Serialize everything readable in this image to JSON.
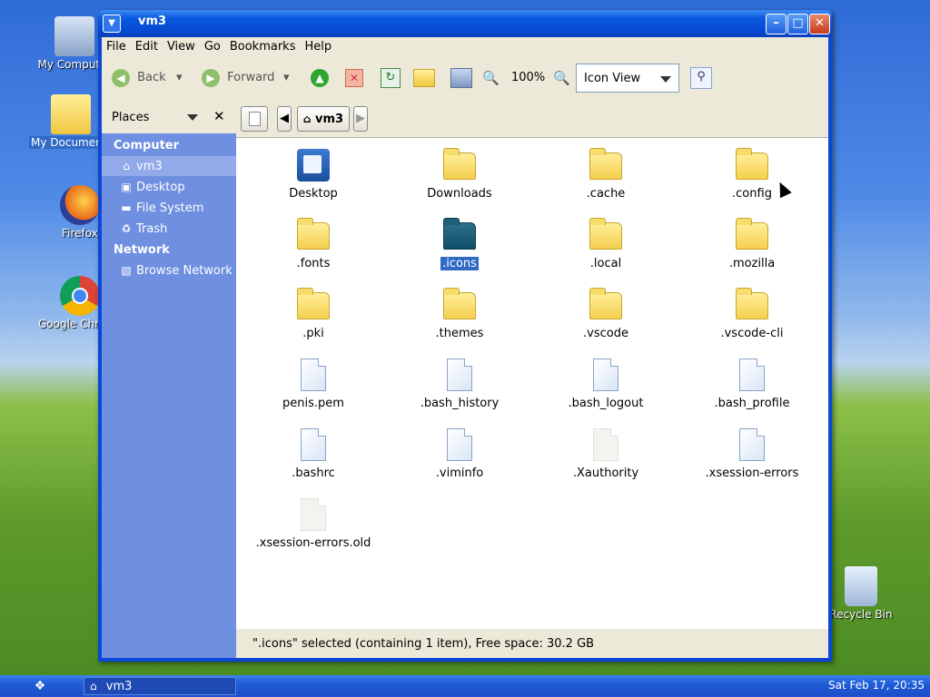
{
  "desktop": {
    "icons": [
      {
        "label": "My Computer"
      },
      {
        "label": "My Documents"
      },
      {
        "label": "Firefox"
      },
      {
        "label": "Google Chrome"
      },
      {
        "label": "Recycle Bin"
      }
    ]
  },
  "window": {
    "title": "vm3",
    "menu": [
      "File",
      "Edit",
      "View",
      "Go",
      "Bookmarks",
      "Help"
    ],
    "toolbar": {
      "back": "Back",
      "forward": "Forward",
      "zoom": "100%",
      "view_mode": "Icon View"
    },
    "sidebar": {
      "header": "Places",
      "groups": [
        {
          "label": "Computer",
          "items": [
            "vm3",
            "Desktop",
            "File System",
            "Trash"
          ]
        },
        {
          "label": "Network",
          "items": [
            "Browse Network"
          ]
        }
      ]
    },
    "path": {
      "current": "vm3"
    },
    "files": [
      {
        "name": "Desktop",
        "type": "desktop"
      },
      {
        "name": "Downloads",
        "type": "folder"
      },
      {
        "name": ".cache",
        "type": "folder"
      },
      {
        "name": ".config",
        "type": "folder"
      },
      {
        "name": ".fonts",
        "type": "folder"
      },
      {
        "name": ".icons",
        "type": "folder-dark"
      },
      {
        "name": ".local",
        "type": "folder"
      },
      {
        "name": ".mozilla",
        "type": "folder"
      },
      {
        "name": ".pki",
        "type": "folder"
      },
      {
        "name": ".themes",
        "type": "folder"
      },
      {
        "name": ".vscode",
        "type": "folder"
      },
      {
        "name": ".vscode-cli",
        "type": "folder"
      },
      {
        "name": "penis.pem",
        "type": "file"
      },
      {
        "name": ".bash_history",
        "type": "file"
      },
      {
        "name": ".bash_logout",
        "type": "file"
      },
      {
        "name": ".bash_profile",
        "type": "file"
      },
      {
        "name": ".bashrc",
        "type": "file"
      },
      {
        "name": ".viminfo",
        "type": "file"
      },
      {
        "name": ".Xauthority",
        "type": "blank"
      },
      {
        "name": ".xsession-errors",
        "type": "file"
      },
      {
        "name": ".xsession-errors.old",
        "type": "blank"
      }
    ],
    "selected_file": ".icons",
    "status": "\".icons\" selected (containing 1 item), Free space: 30.2 GB"
  },
  "taskbar": {
    "task": "vm3",
    "clock": "Sat Feb 17, 20:35"
  },
  "colors": {
    "selection": "#316ac5",
    "sidebar": "#6f8fe0",
    "titlebar": "#0548d0"
  }
}
